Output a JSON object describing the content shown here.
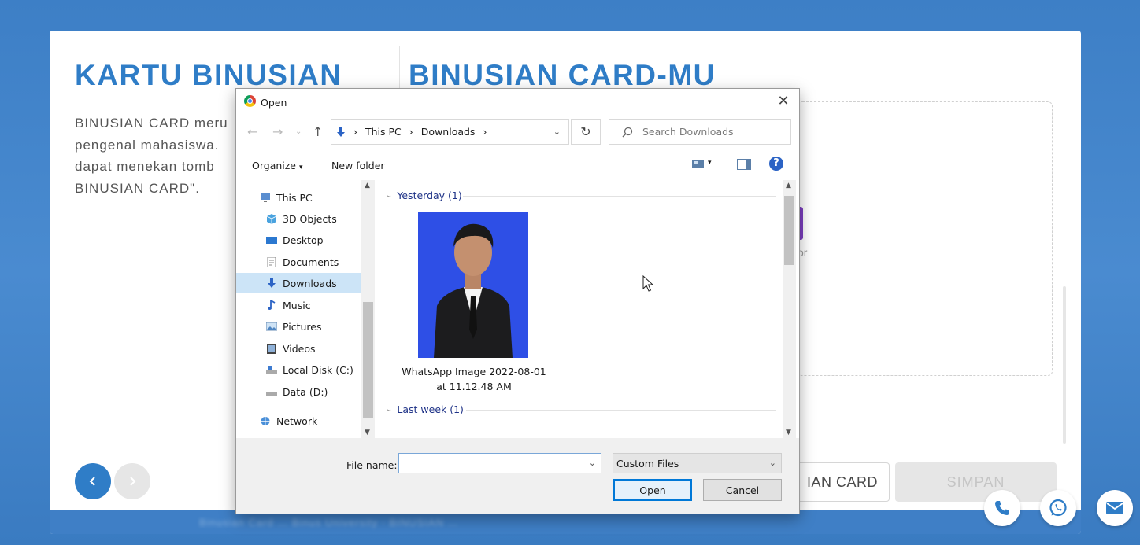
{
  "page": {
    "left_title": "KARTU BINUSIAN",
    "left_desc": [
      "BINUSIAN CARD meru",
      "pengenal mahasiswa.",
      "dapat menekan tomb",
      "BINUSIAN CARD\"."
    ],
    "right_title": "BINUSIAN CARD-MU",
    "upload_or_text": "or",
    "card_button_label": "IAN CARD",
    "save_button_label": "SIMPAN",
    "prev_label": "‹",
    "next_label": "›",
    "footer_text": "Binusian Card … Binus University · BINUSIAN …"
  },
  "dialog": {
    "title": "Open",
    "breadcrumb": [
      "This PC",
      "Downloads"
    ],
    "search_placeholder": "Search Downloads",
    "organize_label": "Organize",
    "new_folder_label": "New folder",
    "nav_items": [
      {
        "label": "This PC",
        "icon": "computer-icon"
      },
      {
        "label": "3D Objects",
        "icon": "cube-icon"
      },
      {
        "label": "Desktop",
        "icon": "desktop-icon"
      },
      {
        "label": "Documents",
        "icon": "document-icon"
      },
      {
        "label": "Downloads",
        "icon": "download-icon",
        "selected": true
      },
      {
        "label": "Music",
        "icon": "music-icon"
      },
      {
        "label": "Pictures",
        "icon": "pictures-icon"
      },
      {
        "label": "Videos",
        "icon": "video-icon"
      },
      {
        "label": "Local Disk (C:)",
        "icon": "disk-icon"
      },
      {
        "label": "Data (D:)",
        "icon": "disk-icon"
      },
      {
        "label": "Network",
        "icon": "network-icon"
      }
    ],
    "groups": [
      {
        "label": "Yesterday (1)"
      },
      {
        "label": "Last week (1)"
      }
    ],
    "file": {
      "name_line1": "WhatsApp Image 2022-08-01",
      "name_line2": "at 11.12.48 AM"
    },
    "file_name_label": "File name:",
    "file_name_value": "",
    "filter_value": "Custom Files",
    "open_label": "Open",
    "cancel_label": "Cancel"
  },
  "colors": {
    "brand_blue": "#2f7dc7",
    "selection": "#cce4f7",
    "accent_purple": "#7d3fc0"
  }
}
